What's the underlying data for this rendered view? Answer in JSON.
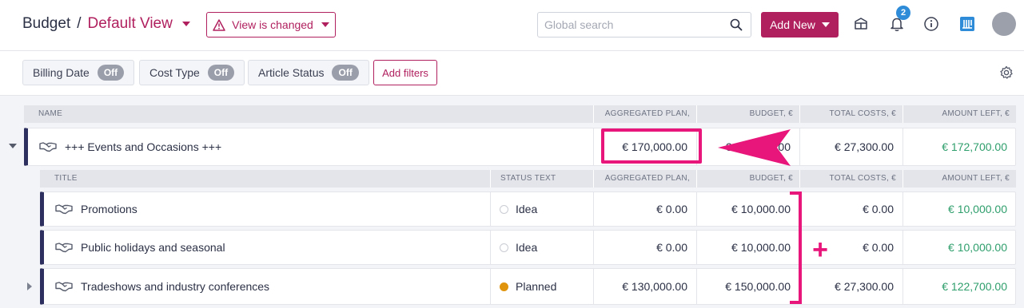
{
  "header": {
    "breadcrumb_root": "Budget",
    "breadcrumb_sep": "/",
    "view_name": "Default View",
    "view_changed_label": "View is changed",
    "search_placeholder": "Global search",
    "add_new_label": "Add New",
    "notification_count": "2"
  },
  "filters": [
    {
      "label": "Billing Date",
      "state": "Off"
    },
    {
      "label": "Cost Type",
      "state": "Off"
    },
    {
      "label": "Article Status",
      "state": "Off"
    }
  ],
  "add_filters_label": "Add filters",
  "table": {
    "columns": {
      "name": "NAME",
      "aggregated_plan": "AGGREGATED PLAN, €",
      "budget": "BUDGET, €",
      "total_costs": "TOTAL COSTS, €",
      "amount_left": "AMOUNT LEFT, €"
    },
    "parent": {
      "name": "+++ Events and Occasions +++",
      "aggregated_plan": "€ 170,000.00",
      "budget": "€ 170,000.00",
      "total_costs": "€ 27,300.00",
      "amount_left": "€ 172,700.00"
    },
    "sub_columns": {
      "title": "TITLE",
      "status_text": "STATUS TEXT",
      "aggregated_plan": "AGGREGATED PLAN, €",
      "budget": "BUDGET, €",
      "total_costs": "TOTAL COSTS, €",
      "amount_left": "AMOUNT LEFT, €"
    },
    "children": [
      {
        "title": "Promotions",
        "status": "Idea",
        "aggregated_plan": "€ 0.00",
        "budget": "€ 10,000.00",
        "total_costs": "€ 0.00",
        "amount_left": "€ 10,000.00"
      },
      {
        "title": "Public holidays and seasonal",
        "status": "Idea",
        "aggregated_plan": "€ 0.00",
        "budget": "€ 10,000.00",
        "total_costs": "€ 0.00",
        "amount_left": "€ 10,000.00"
      },
      {
        "title": "Tradeshows and industry conferences",
        "status": "Planned",
        "aggregated_plan": "€ 130,000.00",
        "budget": "€ 150,000.00",
        "total_costs": "€ 27,300.00",
        "amount_left": "€ 122,700.00"
      }
    ]
  },
  "annotation": {
    "plus_sign": "+"
  },
  "colors": {
    "accent": "#b0205e",
    "annotation": "#e8157a",
    "positive": "#2e9e6c",
    "row_marker": "#2d2f5e",
    "status_planned": "#e0940d"
  }
}
